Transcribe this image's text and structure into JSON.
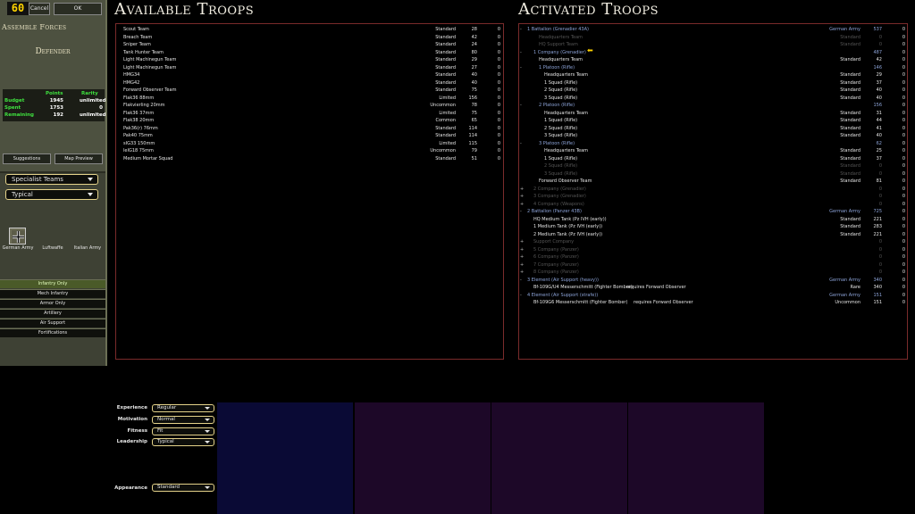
{
  "sidebar": {
    "timer": "60",
    "cancel_label": "Cancel",
    "ok_label": "OK",
    "title": "Assemble Forces",
    "role": "Defender",
    "budget_headers": [
      "Points",
      "Rarity"
    ],
    "budget_rows": [
      {
        "label": "Budget",
        "points": "1945",
        "rarity": "unlimited"
      },
      {
        "label": "Spent",
        "points": "1753",
        "rarity": "0"
      },
      {
        "label": "Remaining",
        "points": "192",
        "rarity": "unlimited"
      }
    ],
    "suggestions_label": "Suggestions",
    "map_preview_label": "Map Preview",
    "category_dropdown": "Specialist Teams",
    "quality_dropdown": "Typical",
    "armies": [
      "German Army",
      "Luftwaffe",
      "Italian Army"
    ],
    "categories": [
      "Infantry Only",
      "Mech Infantry",
      "Armor Only",
      "Artillery",
      "Air Support",
      "Fortifications"
    ],
    "active_category": "Infantry Only"
  },
  "available": {
    "title": "Available Troops",
    "rows": [
      {
        "name": "Scout Team",
        "rarity": "Standard",
        "points": "28",
        "count": "0"
      },
      {
        "name": "Breach Team",
        "rarity": "Standard",
        "points": "42",
        "count": "0"
      },
      {
        "name": "Sniper Team",
        "rarity": "Standard",
        "points": "24",
        "count": "0"
      },
      {
        "name": "Tank Hunter Team",
        "rarity": "Standard",
        "points": "80",
        "count": "0"
      },
      {
        "name": "Light Machinegun Team",
        "rarity": "Standard",
        "points": "29",
        "count": "0"
      },
      {
        "name": "Light Machinegun Team",
        "rarity": "Standard",
        "points": "27",
        "count": "0"
      },
      {
        "name": "HMG34",
        "rarity": "Standard",
        "points": "40",
        "count": "0"
      },
      {
        "name": "HMG42",
        "rarity": "Standard",
        "points": "40",
        "count": "0"
      },
      {
        "name": "Forward Observer Team",
        "rarity": "Standard",
        "points": "75",
        "count": "0"
      },
      {
        "name": "Flak36 88mm",
        "rarity": "Limited",
        "points": "156",
        "count": "0"
      },
      {
        "name": "Flakvierling 20mm",
        "rarity": "Uncommon",
        "points": "78",
        "count": "0"
      },
      {
        "name": "Flak36 37mm",
        "rarity": "Limited",
        "points": "75",
        "count": "0"
      },
      {
        "name": "Flak38 20mm",
        "rarity": "Common",
        "points": "65",
        "count": "0"
      },
      {
        "name": "Pak36(r) 76mm",
        "rarity": "Standard",
        "points": "114",
        "count": "0"
      },
      {
        "name": "Pak40 75mm",
        "rarity": "Standard",
        "points": "114",
        "count": "0"
      },
      {
        "name": "sIG33 150mm",
        "rarity": "Limited",
        "points": "115",
        "count": "0"
      },
      {
        "name": "leIG18 75mm",
        "rarity": "Uncommon",
        "points": "79",
        "count": "0"
      },
      {
        "name": "Medium Mortar Squad",
        "rarity": "Standard",
        "points": "51",
        "count": "0"
      }
    ]
  },
  "activated": {
    "title": "Activated Troops",
    "rows": [
      {
        "exp": "-",
        "indent": 1,
        "name": "1 Battalion (Grenadier 43A)",
        "rarity": "German Army",
        "points": "537",
        "count": "0",
        "style": "blue"
      },
      {
        "exp": "",
        "indent": 3,
        "name": "Headquarters Team",
        "rarity": "Standard",
        "points": "0",
        "count": "0",
        "style": "dim"
      },
      {
        "exp": "",
        "indent": 3,
        "name": "HQ Support Team",
        "rarity": "Standard",
        "points": "0",
        "count": "0",
        "style": "dim"
      },
      {
        "exp": "-",
        "indent": 2,
        "name": "1 Company (Grenadier)",
        "rarity": "",
        "points": "487",
        "count": "0",
        "style": "blue"
      },
      {
        "exp": "",
        "indent": 3,
        "name": "Headquarters Team",
        "rarity": "Standard",
        "points": "42",
        "count": "0",
        "style": ""
      },
      {
        "exp": "-",
        "indent": 3,
        "name": "1 Platoon (Rifle)",
        "rarity": "",
        "points": "146",
        "count": "0",
        "style": "blue"
      },
      {
        "exp": "",
        "indent": 4,
        "name": "Headquarters Team",
        "rarity": "Standard",
        "points": "29",
        "count": "0",
        "style": ""
      },
      {
        "exp": "",
        "indent": 4,
        "name": "1 Squad (Rifle)",
        "rarity": "Standard",
        "points": "37",
        "count": "0",
        "style": ""
      },
      {
        "exp": "",
        "indent": 4,
        "name": "2 Squad (Rifle)",
        "rarity": "Standard",
        "points": "40",
        "count": "0",
        "style": ""
      },
      {
        "exp": "",
        "indent": 4,
        "name": "3 Squad (Rifle)",
        "rarity": "Standard",
        "points": "40",
        "count": "0",
        "style": ""
      },
      {
        "exp": "-",
        "indent": 3,
        "name": "2 Platoon (Rifle)",
        "rarity": "",
        "points": "156",
        "count": "0",
        "style": "blue"
      },
      {
        "exp": "",
        "indent": 4,
        "name": "Headquarters Team",
        "rarity": "Standard",
        "points": "31",
        "count": "0",
        "style": ""
      },
      {
        "exp": "",
        "indent": 4,
        "name": "1 Squad (Rifle)",
        "rarity": "Standard",
        "points": "44",
        "count": "0",
        "style": ""
      },
      {
        "exp": "",
        "indent": 4,
        "name": "2 Squad (Rifle)",
        "rarity": "Standard",
        "points": "41",
        "count": "0",
        "style": ""
      },
      {
        "exp": "",
        "indent": 4,
        "name": "3 Squad (Rifle)",
        "rarity": "Standard",
        "points": "40",
        "count": "0",
        "style": ""
      },
      {
        "exp": "-",
        "indent": 3,
        "name": "3 Platoon (Rifle)",
        "rarity": "",
        "points": "62",
        "count": "0",
        "style": "blue"
      },
      {
        "exp": "",
        "indent": 4,
        "name": "Headquarters Team",
        "rarity": "Standard",
        "points": "25",
        "count": "0",
        "style": ""
      },
      {
        "exp": "",
        "indent": 4,
        "name": "1 Squad (Rifle)",
        "rarity": "Standard",
        "points": "37",
        "count": "0",
        "style": ""
      },
      {
        "exp": "",
        "indent": 4,
        "name": "2 Squad (Rifle)",
        "rarity": "Standard",
        "points": "0",
        "count": "0",
        "style": "dim"
      },
      {
        "exp": "",
        "indent": 4,
        "name": "3 Squad (Rifle)",
        "rarity": "Standard",
        "points": "0",
        "count": "0",
        "style": "dim"
      },
      {
        "exp": "",
        "indent": 3,
        "name": "Forward Observer Team",
        "rarity": "Standard",
        "points": "81",
        "count": "0",
        "style": ""
      },
      {
        "exp": "+",
        "indent": 2,
        "name": "2 Company (Grenadier)",
        "rarity": "",
        "points": "0",
        "count": "0",
        "style": "dim"
      },
      {
        "exp": "+",
        "indent": 2,
        "name": "3 Company (Grenadier)",
        "rarity": "",
        "points": "0",
        "count": "0",
        "style": "dim"
      },
      {
        "exp": "+",
        "indent": 2,
        "name": "4 Company (Weapons)",
        "rarity": "",
        "points": "0",
        "count": "0",
        "style": "dim"
      },
      {
        "exp": "-",
        "indent": 1,
        "name": "2 Battalion (Panzer 43B)",
        "rarity": "German Army",
        "points": "725",
        "count": "0",
        "style": "blue"
      },
      {
        "exp": "",
        "indent": 2,
        "name": "HQ Medium Tank (Pz IVH (early))",
        "rarity": "Standard",
        "points": "221",
        "count": "0",
        "style": ""
      },
      {
        "exp": "",
        "indent": 2,
        "name": "1 Medium Tank (Pz IVH (early))",
        "rarity": "Standard",
        "points": "283",
        "count": "0",
        "style": ""
      },
      {
        "exp": "",
        "indent": 2,
        "name": "2 Medium Tank (Pz IVH (early))",
        "rarity": "Standard",
        "points": "221",
        "count": "0",
        "style": ""
      },
      {
        "exp": "+",
        "indent": 2,
        "name": "Support Company",
        "rarity": "",
        "points": "0",
        "count": "0",
        "style": "dim"
      },
      {
        "exp": "+",
        "indent": 2,
        "name": "5 Company (Panzer)",
        "rarity": "",
        "points": "0",
        "count": "0",
        "style": "dim"
      },
      {
        "exp": "+",
        "indent": 2,
        "name": "6 Company (Panzer)",
        "rarity": "",
        "points": "0",
        "count": "0",
        "style": "dim"
      },
      {
        "exp": "+",
        "indent": 2,
        "name": "7 Company (Panzer)",
        "rarity": "",
        "points": "0",
        "count": "0",
        "style": "dim"
      },
      {
        "exp": "+",
        "indent": 2,
        "name": "8 Company (Panzer)",
        "rarity": "",
        "points": "0",
        "count": "0",
        "style": "dim"
      },
      {
        "exp": "-",
        "indent": 1,
        "name": "3 Element (Air Support (heavy))",
        "rarity": "German Army",
        "points": "340",
        "count": "0",
        "style": "blue"
      },
      {
        "exp": "",
        "indent": 2,
        "name": "Bf-109G/U4 Messerschmitt (Fighter Bomber)",
        "req": "requires Forward Observer",
        "rarity": "Rare",
        "points": "340",
        "count": "0",
        "style": ""
      },
      {
        "exp": "-",
        "indent": 1,
        "name": "4 Element (Air Support (strafe))",
        "rarity": "German Army",
        "points": "151",
        "count": "0",
        "style": "blue"
      },
      {
        "exp": "",
        "indent": 2,
        "name": "Bf-109G6 Messerschmitt (Fighter Bomber)",
        "req": "requires Forward Observer",
        "rarity": "Uncommon",
        "points": "151",
        "count": "0",
        "style": ""
      }
    ]
  },
  "attributes": [
    {
      "label": "Experience",
      "value": "Regular"
    },
    {
      "label": "Motivation",
      "value": "Normal"
    },
    {
      "label": "Fitness",
      "value": "Fit"
    },
    {
      "label": "Leadership",
      "value": "Typical"
    }
  ],
  "appearance": {
    "label": "Appearance",
    "value": "Standard"
  },
  "colors": {
    "panel_border": "#7a2b2b",
    "sidebar": "#4d5140",
    "accent_green": "#3fe03f",
    "timer": "#ffd400"
  }
}
